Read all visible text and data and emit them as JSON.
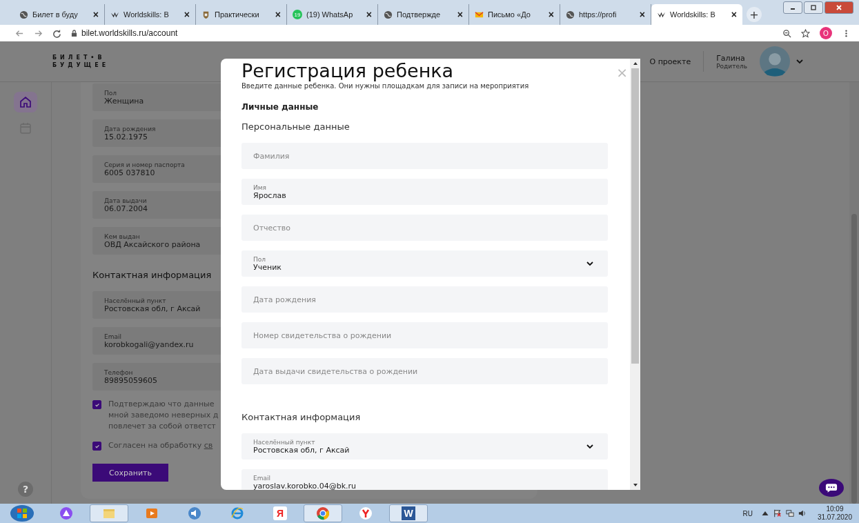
{
  "browser": {
    "tabs": [
      {
        "kind": "globe",
        "title": "Билет в буду",
        "selected": false
      },
      {
        "kind": "logo",
        "title": "Worldskills: B",
        "selected": false
      },
      {
        "kind": "shield",
        "title": "Практически",
        "selected": false
      },
      {
        "kind": "chat",
        "badge": "19",
        "title": "(19) WhatsAp",
        "selected": false
      },
      {
        "kind": "globe",
        "title": "Подтвержде",
        "selected": false
      },
      {
        "kind": "mail",
        "title": "Письмо «До",
        "selected": false
      },
      {
        "kind": "globe",
        "title": "https://profi",
        "selected": false
      },
      {
        "kind": "logo",
        "title": "Worldskills: B",
        "selected": true
      }
    ],
    "new_tab": "+",
    "close": "×",
    "address": "bilet.worldskills.ru/account",
    "profile": "О"
  },
  "header": {
    "logo": [
      "БИЛЕТ•В",
      "БУДУЩЕЕ"
    ],
    "nav_link": "О проекте",
    "user": {
      "name": "Галина",
      "role": "Родитель"
    }
  },
  "sidebar": {
    "items": [
      {
        "kind": "home",
        "selected": true
      },
      {
        "kind": "calendar",
        "selected": false
      }
    ],
    "help": "?"
  },
  "profile": {
    "fields": [
      {
        "label": "Пол",
        "value": "Женщина"
      },
      {
        "label": "Дата рождения",
        "value": "15.02.1975"
      },
      {
        "label": "Серия и номер паспорта",
        "value": "6005 037810"
      },
      {
        "label": "Дата выдачи",
        "value": "06.07.2004"
      },
      {
        "label": "Кем выдан",
        "value": "ОВД Аксайского района"
      }
    ],
    "contact_heading": "Контактная информация",
    "contact_fields": [
      {
        "label": "Населённый пункт",
        "value": "Ростовская обл, г Аксай"
      },
      {
        "label": "Email",
        "value": "korobkogali@yandex.ru"
      },
      {
        "label": "Телефон",
        "value": "89895059605"
      }
    ],
    "checkboxes": [
      {
        "lines": [
          "Подтверждаю что данные",
          "мной заведомо неверных д",
          "повлечет за собой ответст"
        ],
        "checked": true
      },
      {
        "lines": [
          "Согласен на обработку "
        ],
        "link": "св",
        "checked": true
      }
    ],
    "save": "Сохранить"
  },
  "modal": {
    "title": "Регистрация ребенка",
    "subtitle": "Введите данные ребенка. Они нужны площадкам для записи на мероприятия",
    "close": "×",
    "section": "Личные данные",
    "subsection": "Персональные данные",
    "fields": [
      {
        "kind": "text",
        "placeholder": "Фамилия"
      },
      {
        "kind": "text",
        "label": "Имя",
        "value": "Ярослав"
      },
      {
        "kind": "text",
        "placeholder": "Отчество"
      },
      {
        "kind": "select",
        "label": "Пол",
        "value": "Ученик"
      },
      {
        "kind": "text",
        "placeholder": "Дата рождения"
      },
      {
        "kind": "text",
        "placeholder": "Номер свидетельства о рождении"
      },
      {
        "kind": "text",
        "placeholder": "Дата выдачи свидетельства о рождении"
      }
    ],
    "contact_heading": "Контактная информация",
    "contact_fields": [
      {
        "kind": "select",
        "label": "Населённый пункт",
        "value": "Ростовская обл, г Аксай"
      },
      {
        "kind": "text",
        "label": "Email",
        "value": "yaroslav.korobko.04@bk.ru"
      }
    ]
  },
  "taskbar": {
    "apps": [
      {
        "kind": "alice",
        "selected": false
      },
      {
        "kind": "folder",
        "selected": true
      },
      {
        "kind": "player",
        "selected": false
      },
      {
        "kind": "sound",
        "selected": false
      },
      {
        "kind": "ie",
        "selected": false
      },
      {
        "kind": "yandex",
        "glyph": "Я",
        "selected": false
      },
      {
        "kind": "chrome",
        "selected": true
      },
      {
        "kind": "ybrowser",
        "selected": false
      },
      {
        "kind": "word",
        "glyph": "W",
        "selected": true
      }
    ],
    "language": "RU",
    "time": "10:09",
    "date": "31.07.2020"
  }
}
